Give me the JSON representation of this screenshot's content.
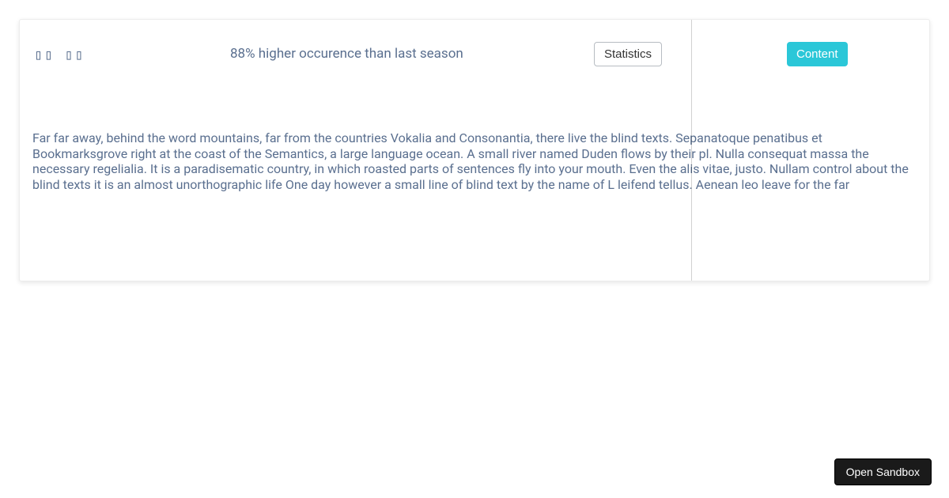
{
  "icons": "▯▯ ▯▯",
  "headline": "88% higher occurence than last season",
  "statsLabel": "Statistics",
  "contentLabel": "Content",
  "paragraph": "Far far away, behind the word mountains, far from the countries Vokalia and Consonantia, there live the blind texts. Sepanatoque penatibus et Bookmarksgrove right at the coast of the Semantics, a large language ocean. A small river named Duden flows by their pl. Nulla consequat massa the necessary regelialia. It is a paradisematic country, in which roasted parts of sentences fly into your mouth. Even the alis vitae, justo. Nullam control about the blind texts it is an almost unorthographic life One day however a small line of blind text by the name of L leifend tellus. Aenean leo leave for the far",
  "sandboxLabel": "Open Sandbox"
}
